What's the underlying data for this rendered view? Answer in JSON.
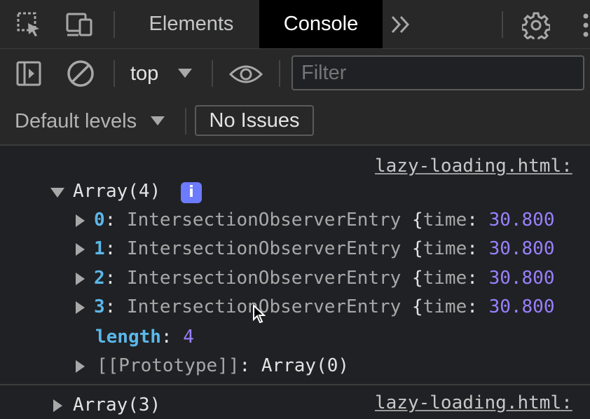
{
  "tabs": [
    {
      "label": "Elements",
      "active": false
    },
    {
      "label": "Console",
      "active": true
    }
  ],
  "toolbar": {
    "context": "top",
    "filter_placeholder": "Filter",
    "levels_label": "Default levels",
    "issues_label": "No Issues"
  },
  "icons": {
    "inspect": "select-element-icon",
    "device": "device-toolbar-icon",
    "more_tabs": "double-chevron-right-icon",
    "settings": "gear-icon",
    "kebab": "more-vertical-icon",
    "sidebar": "sidebar-toggle-icon",
    "clear": "clear-console-icon",
    "dropdown": "caret-down-icon",
    "eye": "eye-icon",
    "info": "info-icon",
    "cursor": "mouse-cursor-icon"
  },
  "colors": {
    "background": "#202124",
    "toolbar": "#282828",
    "active_tab": "#000000",
    "key": "#7ec5ff",
    "number": "#9980ff",
    "badge": "#6c7bff"
  },
  "console": {
    "entries": [
      {
        "source": "lazy-loading.html:",
        "header": "Array(4)",
        "info_badge": "i",
        "items": [
          {
            "index": "0",
            "type": "IntersectionObserverEntry",
            "brace": "{",
            "prop": "time",
            "value": "30.800"
          },
          {
            "index": "1",
            "type": "IntersectionObserverEntry",
            "brace": "{",
            "prop": "time",
            "value": "30.800"
          },
          {
            "index": "2",
            "type": "IntersectionObserverEntry",
            "brace": "{",
            "prop": "time",
            "value": "30.800"
          },
          {
            "index": "3",
            "type": "IntersectionObserverEntry",
            "brace": "{",
            "prop": "time",
            "value": "30.800"
          }
        ],
        "length_key": "length",
        "length_value": "4",
        "prototype_key": "[[Prototype]]",
        "prototype_value": "Array(0)"
      },
      {
        "source": "lazy-loading.html:",
        "header": "Array(3)"
      }
    ]
  }
}
